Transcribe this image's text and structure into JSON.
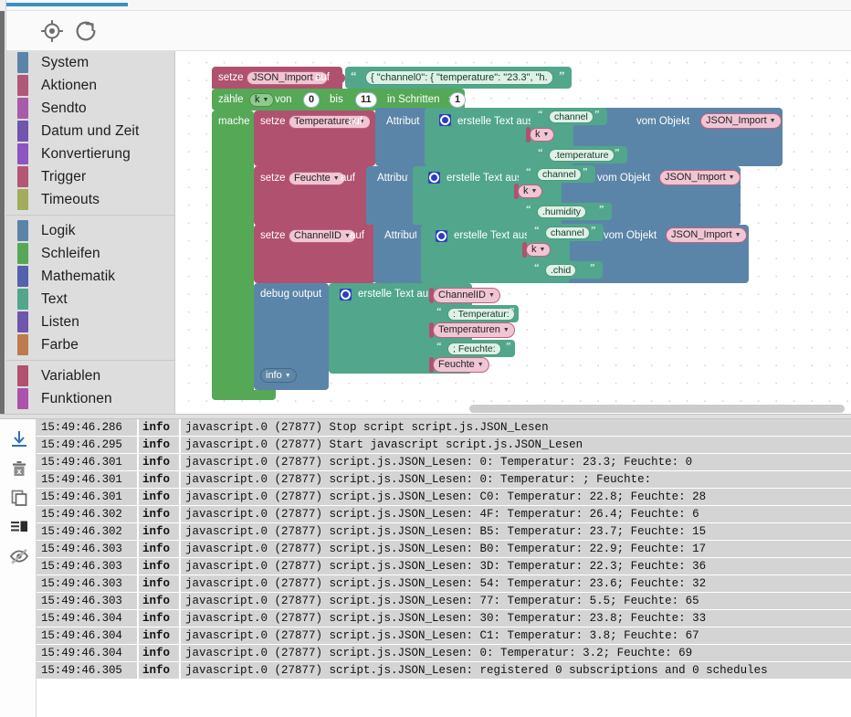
{
  "toolbar": {
    "buttons": [
      {
        "name": "center-blocks-icon",
        "title": "Zentrieren"
      },
      {
        "name": "reload-icon",
        "title": "Neu laden"
      }
    ]
  },
  "toolbox": {
    "groups": [
      {
        "items": [
          {
            "label": "System",
            "color": "#5b85a8"
          },
          {
            "label": "Aktionen",
            "color": "#b05878"
          },
          {
            "label": "Sendto",
            "color": "#a85ba8"
          },
          {
            "label": "Datum und Zeit",
            "color": "#6f55ac"
          },
          {
            "label": "Konvertierung",
            "color": "#8c55c0"
          },
          {
            "label": "Trigger",
            "color": "#b45775"
          },
          {
            "label": "Timeouts",
            "color": "#a2ac5c"
          }
        ]
      },
      {
        "items": [
          {
            "label": "Logik",
            "color": "#5b85a8"
          },
          {
            "label": "Schleifen",
            "color": "#55a855"
          },
          {
            "label": "Mathematik",
            "color": "#5461ab"
          },
          {
            "label": "Text",
            "color": "#51a68c"
          },
          {
            "label": "Listen",
            "color": "#6f55ac"
          },
          {
            "label": "Farbe",
            "color": "#bb7b4e"
          }
        ]
      },
      {
        "items": [
          {
            "label": "Variablen",
            "color": "#b0516f"
          },
          {
            "label": "Funktionen",
            "color": "#ab52ab"
          }
        ]
      }
    ]
  },
  "workspace": {
    "set_json_import": {
      "setze": "setze",
      "variable": "JSON_Import",
      "auf": "auf",
      "text_value": "{ \"channel0\": {   \"temperature\": \"23.3\",   \"h."
    },
    "for_loop": {
      "zaehle": "zähle",
      "counter": "k",
      "von": "von",
      "from": "0",
      "bis": "bis",
      "to": "11",
      "in_schritten_von": "in Schritten von",
      "step": "1",
      "mache": "mache"
    },
    "statements": [
      {
        "setze": "setze",
        "variable": "Temperaturen",
        "auf": "auf",
        "attribut": "Attribut",
        "erstelle_text_aus": "erstelle Text aus",
        "parts": [
          {
            "kind": "text",
            "value": "channel"
          },
          {
            "kind": "var",
            "value": "k"
          },
          {
            "kind": "text",
            "value": ".temperature"
          }
        ],
        "vom_objekt": "vom Objekt",
        "object": "JSON_Import"
      },
      {
        "setze": "setze",
        "variable": "Feuchte",
        "auf": "auf",
        "attribut": "Attribut",
        "erstelle_text_aus": "erstelle Text aus",
        "parts": [
          {
            "kind": "text",
            "value": "channel"
          },
          {
            "kind": "var",
            "value": "k"
          },
          {
            "kind": "text",
            "value": ".humidity"
          }
        ],
        "vom_objekt": "vom Objekt",
        "object": "JSON_Import"
      },
      {
        "setze": "setze",
        "variable": "ChannelID",
        "auf": "auf",
        "attribut": "Attribut",
        "erstelle_text_aus": "erstelle Text aus",
        "parts": [
          {
            "kind": "text",
            "value": "channel"
          },
          {
            "kind": "var",
            "value": "k"
          },
          {
            "kind": "text",
            "value": ".chid"
          }
        ],
        "vom_objekt": "vom Objekt",
        "object": "JSON_Import"
      }
    ],
    "debug_block": {
      "label": "debug output",
      "erstelle_text_aus": "erstelle Text aus",
      "severity": "info",
      "parts": [
        {
          "kind": "var",
          "value": "ChannelID"
        },
        {
          "kind": "text",
          "value": ": Temperatur: "
        },
        {
          "kind": "var",
          "value": "Temperaturen"
        },
        {
          "kind": "text",
          "value": "; Feuchte: "
        },
        {
          "kind": "var",
          "value": "Feuchte"
        }
      ]
    }
  },
  "log": {
    "tools": [
      {
        "name": "scroll-to-bottom-icon"
      },
      {
        "name": "clear-log-icon"
      },
      {
        "name": "copy-log-icon"
      },
      {
        "name": "toggle-columns-icon"
      },
      {
        "name": "hide-log-icon"
      }
    ],
    "rows": [
      {
        "time": "15:49:46.286",
        "severity": "info",
        "message": "javascript.0 (27877) Stop script script.js.JSON_Lesen"
      },
      {
        "time": "15:49:46.295",
        "severity": "info",
        "message": "javascript.0 (27877) Start javascript script.js.JSON_Lesen"
      },
      {
        "time": "15:49:46.301",
        "severity": "info",
        "message": "javascript.0 (27877) script.js.JSON_Lesen: 0: Temperatur: 23.3; Feuchte: 0"
      },
      {
        "time": "15:49:46.301",
        "severity": "info",
        "message": "javascript.0 (27877) script.js.JSON_Lesen: 0: Temperatur: ; Feuchte:"
      },
      {
        "time": "15:49:46.301",
        "severity": "info",
        "message": "javascript.0 (27877) script.js.JSON_Lesen: C0: Temperatur: 22.8; Feuchte: 28"
      },
      {
        "time": "15:49:46.302",
        "severity": "info",
        "message": "javascript.0 (27877) script.js.JSON_Lesen: 4F: Temperatur: 26.4; Feuchte: 6"
      },
      {
        "time": "15:49:46.302",
        "severity": "info",
        "message": "javascript.0 (27877) script.js.JSON_Lesen: B5: Temperatur: 23.7; Feuchte: 15"
      },
      {
        "time": "15:49:46.303",
        "severity": "info",
        "message": "javascript.0 (27877) script.js.JSON_Lesen: B0: Temperatur: 22.9; Feuchte: 17"
      },
      {
        "time": "15:49:46.303",
        "severity": "info",
        "message": "javascript.0 (27877) script.js.JSON_Lesen: 3D: Temperatur: 22.3; Feuchte: 36"
      },
      {
        "time": "15:49:46.303",
        "severity": "info",
        "message": "javascript.0 (27877) script.js.JSON_Lesen: 54: Temperatur: 23.6; Feuchte: 32"
      },
      {
        "time": "15:49:46.303",
        "severity": "info",
        "message": "javascript.0 (27877) script.js.JSON_Lesen: 77: Temperatur: 5.5; Feuchte: 65"
      },
      {
        "time": "15:49:46.304",
        "severity": "info",
        "message": "javascript.0 (27877) script.js.JSON_Lesen: 30: Temperatur: 23.8; Feuchte: 33"
      },
      {
        "time": "15:49:46.304",
        "severity": "info",
        "message": "javascript.0 (27877) script.js.JSON_Lesen: C1: Temperatur: 3.8; Feuchte: 67"
      },
      {
        "time": "15:49:46.304",
        "severity": "info",
        "message": "javascript.0 (27877) script.js.JSON_Lesen: 0: Temperatur: 3.2; Feuchte: 69"
      },
      {
        "time": "15:49:46.305",
        "severity": "info",
        "message": "javascript.0 (27877) script.js.JSON_Lesen: registered 0 subscriptions and 0 schedules"
      }
    ]
  },
  "colors": {
    "accent": "#3b8fc4",
    "variables_block": "#b0516f",
    "loops_block": "#55a855",
    "text_block": "#51a68c",
    "objects_block": "#5b85a8",
    "log_row_bg": "#d4d4d4"
  }
}
